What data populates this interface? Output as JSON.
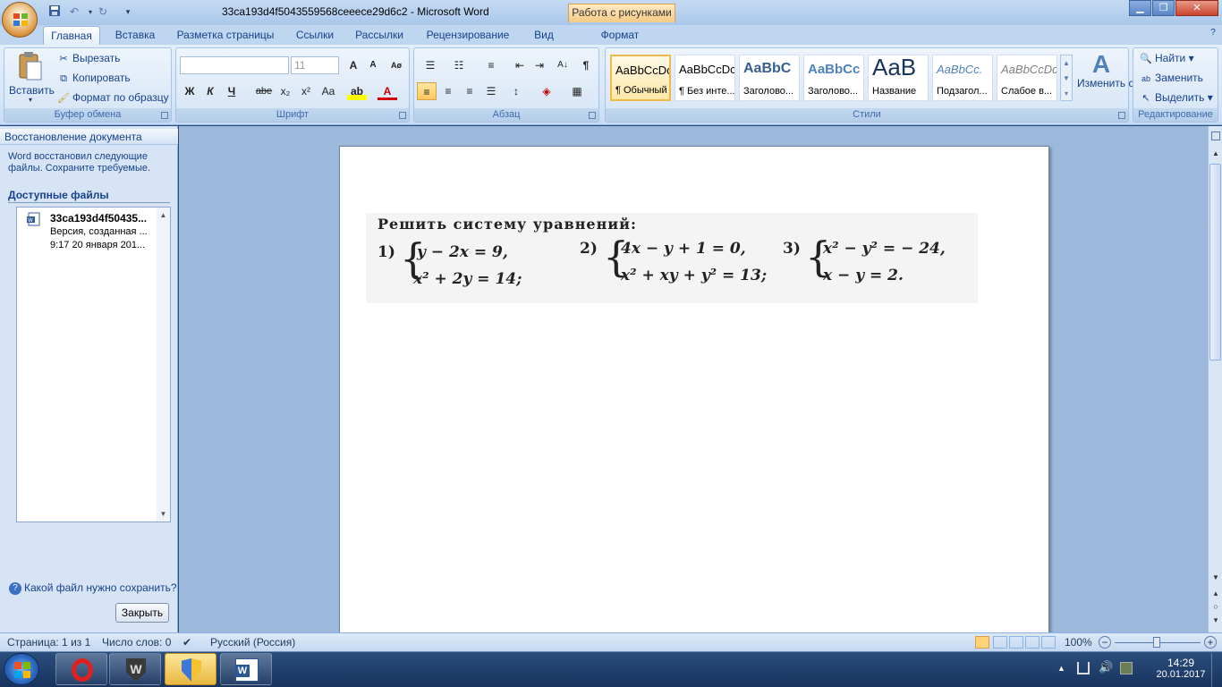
{
  "titlebar": {
    "doc_title": "33ca193d4f5043559568ceeece29d6c2 - Microsoft Word",
    "context_tab": "Работа с рисунками",
    "minimize_icon": "minimize-icon",
    "maximize_icon": "maximize-icon",
    "close_icon": "close-icon"
  },
  "tabs": [
    "Главная",
    "Вставка",
    "Разметка страницы",
    "Ссылки",
    "Рассылки",
    "Рецензирование",
    "Вид",
    "Формат"
  ],
  "clipboard": {
    "paste": "Вставить",
    "cut": "Вырезать",
    "copy": "Копировать",
    "format_painter": "Формат по образцу",
    "label": "Буфер обмена"
  },
  "font": {
    "name_value": "",
    "size_value": "11",
    "bold": "Ж",
    "italic": "К",
    "underline": "Ч",
    "strike": "abe",
    "sub": "x₂",
    "sup": "x²",
    "case": "Aa",
    "grow": "A",
    "shrink": "A",
    "label": "Шрифт"
  },
  "paragraph": {
    "label": "Абзац"
  },
  "styles": {
    "items": [
      {
        "preview": "AaBbCcDc",
        "name": "¶ Обычный"
      },
      {
        "preview": "AaBbCcDc",
        "name": "¶ Без инте..."
      },
      {
        "preview": "AaBbC",
        "name": "Заголово..."
      },
      {
        "preview": "AaBbCc",
        "name": "Заголово..."
      },
      {
        "preview": "AaB",
        "name": "Название"
      },
      {
        "preview": "AaBbCc.",
        "name": "Подзагол..."
      },
      {
        "preview": "AaBbCcDc",
        "name": "Слабое в..."
      }
    ],
    "change_styles": "Изменить стили",
    "label": "Стили"
  },
  "editing": {
    "find": "Найти",
    "replace": "Заменить",
    "select": "Выделить",
    "label": "Редактирование"
  },
  "recovery": {
    "header": "Восстановление документа",
    "description": "Word восстановил следующие файлы.  Сохраните требуемые.",
    "available": "Доступные файлы",
    "file_name": "33ca193d4f50435...",
    "file_version": "Версия, созданная ...",
    "file_time": "9:17 20 января 201...",
    "help": "Какой файл нужно сохранить?",
    "close": "Закрыть"
  },
  "document": {
    "heading": "Решить систему уравнений:",
    "problems": [
      {
        "num": "1)",
        "eq1": "y − 2x = 9,",
        "eq2": "x² + 2y = 14;"
      },
      {
        "num": "2)",
        "eq1": "4x − y + 1 = 0,",
        "eq2": "x² + xy + y² = 13;"
      },
      {
        "num": "3)",
        "eq1": "x² − y² = − 24,",
        "eq2": "x − y = 2."
      }
    ]
  },
  "statusbar": {
    "page": "Страница: 1 из 1",
    "words": "Число слов: 0",
    "language": "Русский (Россия)",
    "zoom": "100%"
  },
  "taskbar": {
    "time": "14:29",
    "date": "20.01.2017"
  },
  "colors": {
    "ribbon_bg": "#dae7f7",
    "accent": "#15428b",
    "selected_style": "#f0b94a"
  }
}
